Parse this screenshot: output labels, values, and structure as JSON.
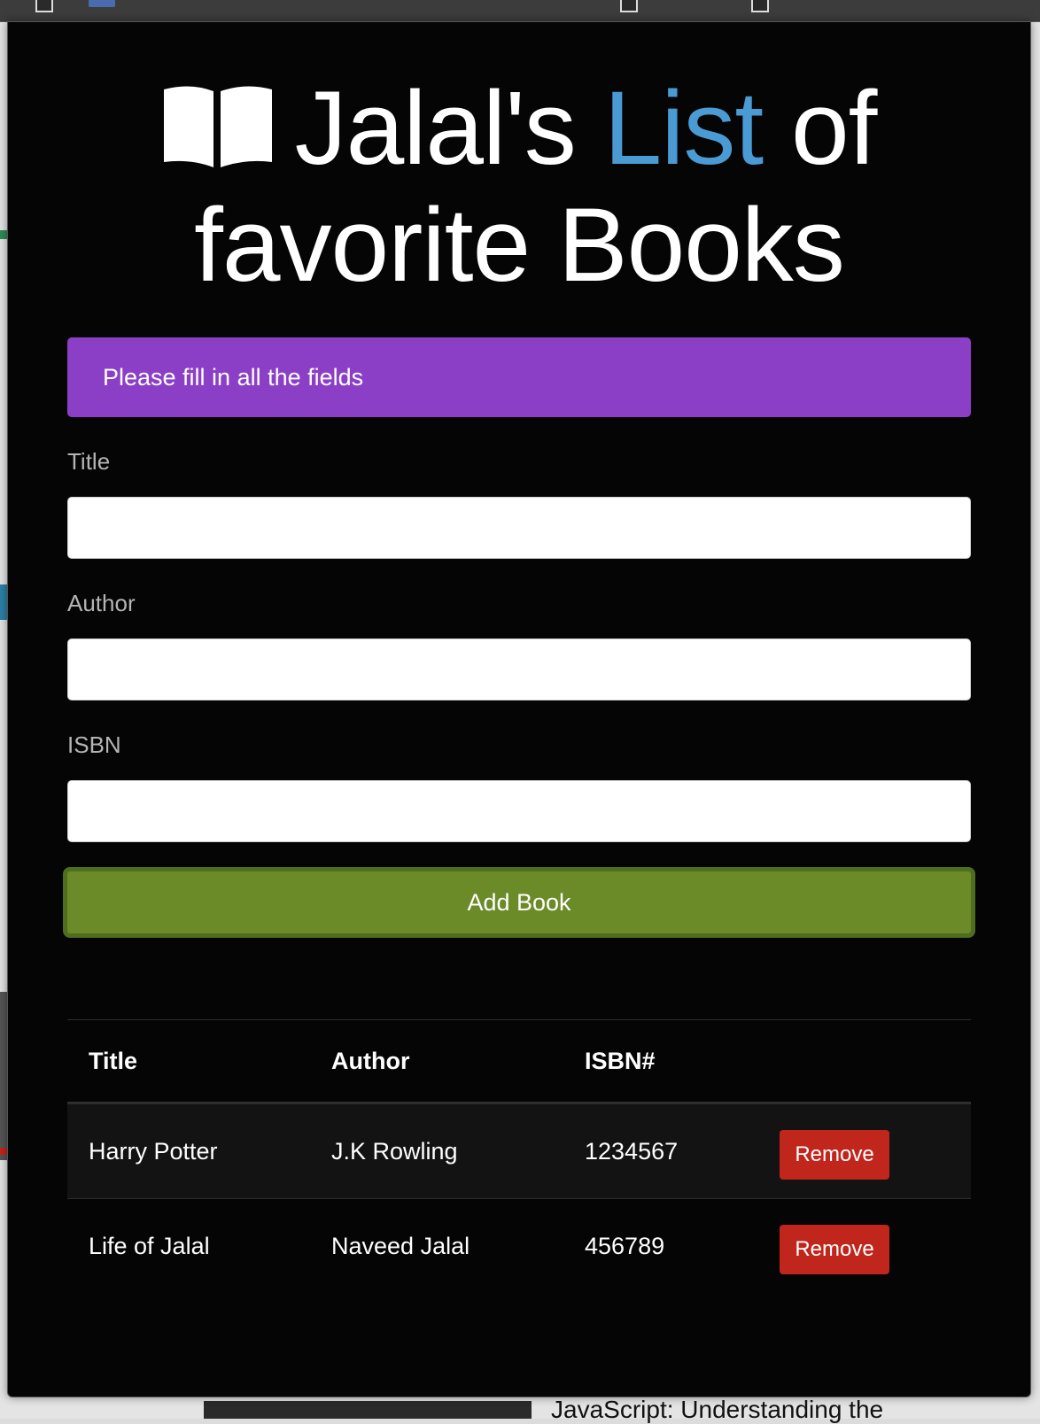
{
  "header": {
    "title_part1": "Jalal's",
    "title_accent": "List",
    "title_part2": "of",
    "title_line2": "favorite Books",
    "icon": "book-open-icon"
  },
  "alert": {
    "message": "Please fill in all the fields",
    "color": "#8b3fc6"
  },
  "form": {
    "fields": [
      {
        "label": "Title",
        "value": ""
      },
      {
        "label": "Author",
        "value": ""
      },
      {
        "label": "ISBN",
        "value": ""
      }
    ],
    "submit_label": "Add Book",
    "submit_color": "#6b8a28"
  },
  "table": {
    "headers": [
      "Title",
      "Author",
      "ISBN#"
    ],
    "rows": [
      {
        "title": "Harry Potter",
        "author": "J.K Rowling",
        "isbn": "1234567",
        "action": "Remove"
      },
      {
        "title": "Life of Jalal",
        "author": "Naveed Jalal",
        "isbn": "456789",
        "action": "Remove"
      }
    ],
    "remove_color": "#c0261c"
  },
  "backdrop": {
    "partial_text": "JavaScript: Understanding the"
  },
  "colors": {
    "accent": "#4a9ad4",
    "background": "#050505"
  }
}
